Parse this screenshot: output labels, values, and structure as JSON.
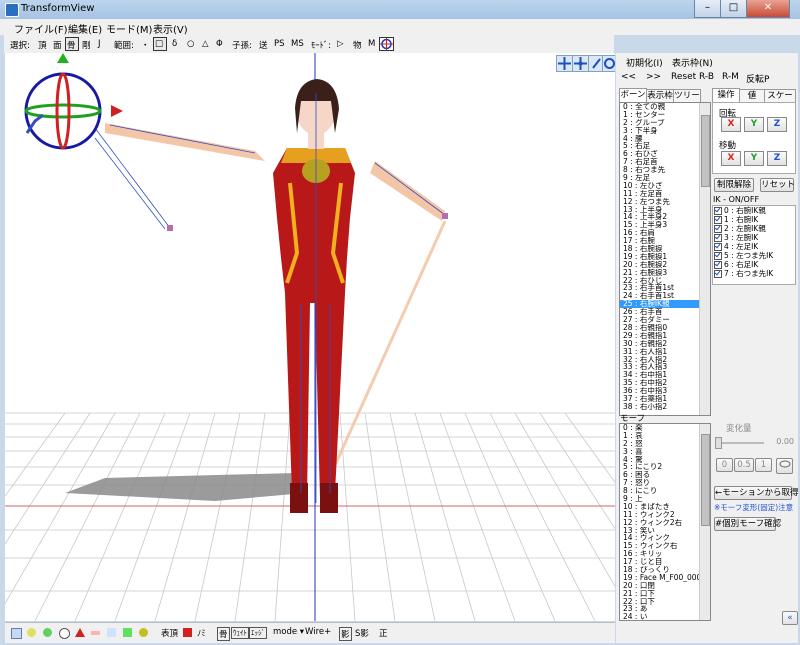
{
  "window": {
    "title": "TransformView",
    "minimize": "–",
    "maximize": "□",
    "close": "✕"
  },
  "menu": [
    "ファイル(F)",
    "編集(E)",
    "モード(M)",
    "表示(V)"
  ],
  "toolbar": {
    "select_label": "選択:",
    "select_items": [
      "頂",
      "面",
      "骨",
      "剛",
      "J"
    ],
    "range_label": "範囲:",
    "range_items": [
      "・",
      "□",
      "δ",
      "○",
      "△",
      "Φ"
    ],
    "child_label": "子孫:",
    "child_items": [
      "送",
      "PS",
      "MS"
    ],
    "mode_label": "ﾓｰﾄﾞ:",
    "mode_items": [
      "▷",
      "物",
      "M"
    ]
  },
  "statusbar": {
    "surface": "表頂",
    "normal": "ﾉﾐ",
    "bone": "骨",
    "weight": "ｳｪｲﾄ",
    "edge": "ｴｯｼﾞ",
    "mode": "mode ▾",
    "wire": "Wire+",
    "shadow_btn": "影",
    "self_shadow": "S影",
    "front": "正"
  },
  "right_panel": {
    "header": {
      "init": "初期化(I)",
      "display": "表示枠(N)"
    },
    "nav": {
      "prev": "<<",
      "next": ">>",
      "reset": "Reset",
      "rb": "R-B",
      "rm": "R-M",
      "flip": "反転P"
    },
    "bone_tabs": [
      "ボーン",
      "表示枠",
      "ツリー"
    ],
    "bones": [
      "0 : 全ての親",
      "1 : センター",
      "2 : グルーブ",
      "3 : 下半身",
      "4 : 腰",
      "5 : 右足",
      "6 : 右ひざ",
      "7 : 右足首",
      "8 : 右つま先",
      "9 : 左足",
      "10 : 左ひざ",
      "11 : 左足首",
      "12 : 左つま先",
      "13 : 上半身",
      "14 : 上半身2",
      "15 : 上半身3",
      "16 : 右肩",
      "17 : 右腕",
      "18 : 右腕捩",
      "19 : 右腕捩1",
      "20 : 右腕捩2",
      "21 : 右腕捩3",
      "22 : 右ひじ",
      "23 : 右手首1st",
      "24 : 右手首1st",
      "25 : 右腕IK親",
      "26 : 右手首",
      "27 : 右ダミー",
      "28 : 右親指0",
      "29 : 右親指1",
      "30 : 右親指2",
      "31 : 右人指1",
      "32 : 右人指2",
      "33 : 右人指3",
      "34 : 右中指1",
      "35 : 右中指2",
      "36 : 右中指3",
      "37 : 右薬指1",
      "38 : 右小指2"
    ],
    "selected_bone_index": 25,
    "op_tabs": [
      "操作",
      "値",
      "スケール"
    ],
    "rotation_label": "回転",
    "move_label": "移動",
    "axis": [
      "X",
      "Y",
      "Z"
    ],
    "axis_colors": [
      "#e02020",
      "#20a020",
      "#2050d0"
    ],
    "release_btn": "制限解除",
    "reset_btn": "リセット",
    "ik_title": "IK - ON/OFF",
    "ik_items": [
      "0 : 右腕IK親",
      "1 : 右腕IK",
      "2 : 左腕IK親",
      "3 : 左腕IK",
      "4 : 左足IK",
      "5 : 左つま先IK",
      "6 : 右足IK",
      "7 : 右つま先IK"
    ],
    "morph_title": "モーフ",
    "morphs": [
      "0 : 楽",
      "1 : 哀",
      "2 : 怒",
      "3 : 喜",
      "4 : 驚",
      "5 : にこり2",
      "6 : 困る",
      "7 : 怒り",
      "8 : にこり",
      "9 : 上",
      "10 : まばたき",
      "11 : ウィンク2",
      "12 : ウィンク2右",
      "13 : 笑い",
      "14 : ウィンク",
      "15 : ウィンク右",
      "16 : キリッ",
      "17 : じと目",
      "18 : ぴっくり",
      "19 : Face M_F00_000_00",
      "20 : 口閉",
      "21 : 口下",
      "22 : 口下",
      "23 : あ",
      "24 : い"
    ],
    "change_label": "変化量",
    "change_value": "0.00",
    "quick_values": [
      "0",
      "0.5",
      "1"
    ],
    "get_motion": "←モーションから取得",
    "note": "※モーフ変形(固定)注意",
    "morph_check": "#個別モーフ確認"
  }
}
